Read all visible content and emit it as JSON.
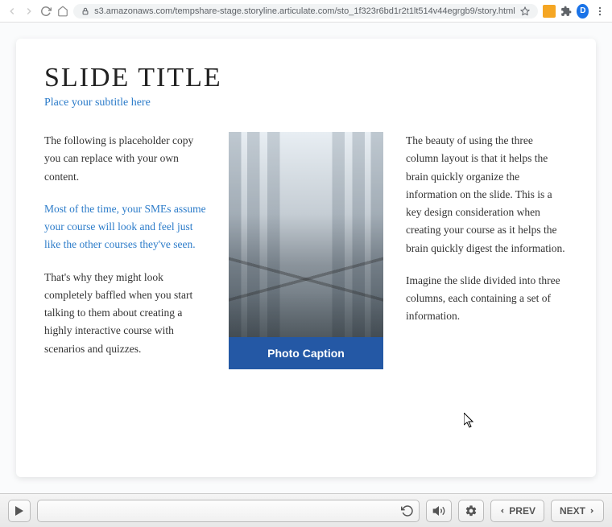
{
  "browser": {
    "url": "s3.amazonaws.com/tempshare-stage.storyline.articulate.com/sto_1f323r6bd1r2t1lt514v44egrgb9/story.html",
    "profile_letter": "D"
  },
  "slide": {
    "title": "SLIDE TITLE",
    "subtitle": "Place your subtitle here",
    "col1_p1": "The following is placeholder copy you can replace with your own content.",
    "col1_p2": "Most of the time, your SMEs assume your course will look and feel just like the other courses they've seen.",
    "col1_p3": "That's why they might look completely baffled when you start talking to them about creating a highly interactive course with scenarios and quizzes.",
    "photo_caption": "Photo Caption",
    "col3_p1": "The beauty of using the three column layout is that it helps the brain quickly organize the information on the slide. This is a key design consideration when creating your course as it helps the brain quickly digest the information.",
    "col3_p2": "Imagine the slide divided into three columns, each containing a set of information."
  },
  "player": {
    "prev_label": "PREV",
    "next_label": "NEXT"
  }
}
